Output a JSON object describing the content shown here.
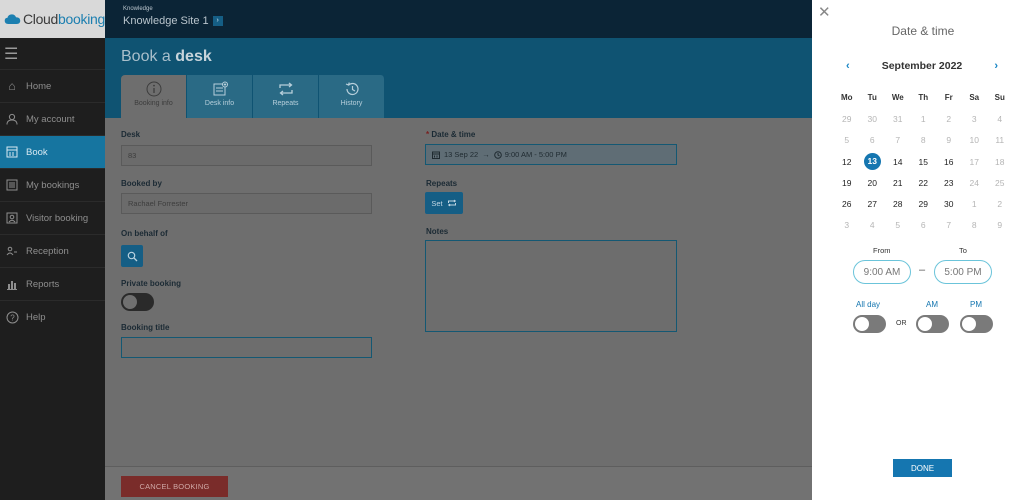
{
  "logo": {
    "brand_part1": "Cloud",
    "brand_part2": "booking"
  },
  "sidebar": {
    "items": [
      {
        "label": "Home",
        "icon": "home-icon"
      },
      {
        "label": "My account",
        "icon": "user-icon"
      },
      {
        "label": "Book",
        "icon": "book-icon",
        "active": true
      },
      {
        "label": "My bookings",
        "icon": "list-icon"
      },
      {
        "label": "Visitor booking",
        "icon": "visitor-icon"
      },
      {
        "label": "Reception",
        "icon": "reception-icon"
      },
      {
        "label": "Reports",
        "icon": "reports-icon"
      },
      {
        "label": "Help",
        "icon": "help-icon"
      }
    ]
  },
  "topbar": {
    "label": "Knowledge",
    "site": "Knowledge Site 1"
  },
  "page": {
    "title_prefix": "Book a ",
    "title_bold": "desk"
  },
  "tabs": [
    {
      "label": "Booking info",
      "icon": "info-icon"
    },
    {
      "label": "Desk info",
      "icon": "desk-icon"
    },
    {
      "label": "Repeats",
      "icon": "repeat-icon"
    },
    {
      "label": "History",
      "icon": "history-icon"
    }
  ],
  "form": {
    "desk_label": "Desk",
    "desk_value": "83",
    "booked_by_label": "Booked by",
    "booked_by_value": "Rachael Forrester",
    "on_behalf_label": "On behalf of",
    "private_label": "Private booking",
    "title_label": "Booking title",
    "title_value": "",
    "datetime_req": "*",
    "datetime_label": "Date & time",
    "datetime_date": "13 Sep 22",
    "datetime_arrow": "→",
    "datetime_range": "9:00 AM - 5:00 PM",
    "repeats_label": "Repeats",
    "set_label": "Set",
    "notes_label": "Notes"
  },
  "footer": {
    "cancel_label": "CANCEL BOOKING"
  },
  "panel": {
    "title": "Date & time",
    "month": "September 2022",
    "weekdays": [
      "Mo",
      "Tu",
      "We",
      "Th",
      "Fr",
      "Sa",
      "Su"
    ],
    "weeks": [
      [
        "29",
        "30",
        "31",
        "1",
        "2",
        "3",
        "4"
      ],
      [
        "5",
        "6",
        "7",
        "8",
        "9",
        "10",
        "11"
      ],
      [
        "12",
        "13",
        "14",
        "15",
        "16",
        "17",
        "18"
      ],
      [
        "19",
        "20",
        "21",
        "22",
        "23",
        "24",
        "25"
      ],
      [
        "26",
        "27",
        "28",
        "29",
        "30",
        "1",
        "2"
      ],
      [
        "3",
        "4",
        "5",
        "6",
        "7",
        "8",
        "9"
      ]
    ],
    "from_label": "From",
    "to_label": "To",
    "from_value": "9:00 AM",
    "to_value": "5:00 PM",
    "dash": "–",
    "all_day_label": "All day",
    "am_label": "AM",
    "pm_label": "PM",
    "or_label": "OR",
    "done_label": "DONE"
  },
  "colors": {
    "accent": "#1576b0",
    "sidebar_active": "#1675a0",
    "cancel": "#c0392b"
  }
}
